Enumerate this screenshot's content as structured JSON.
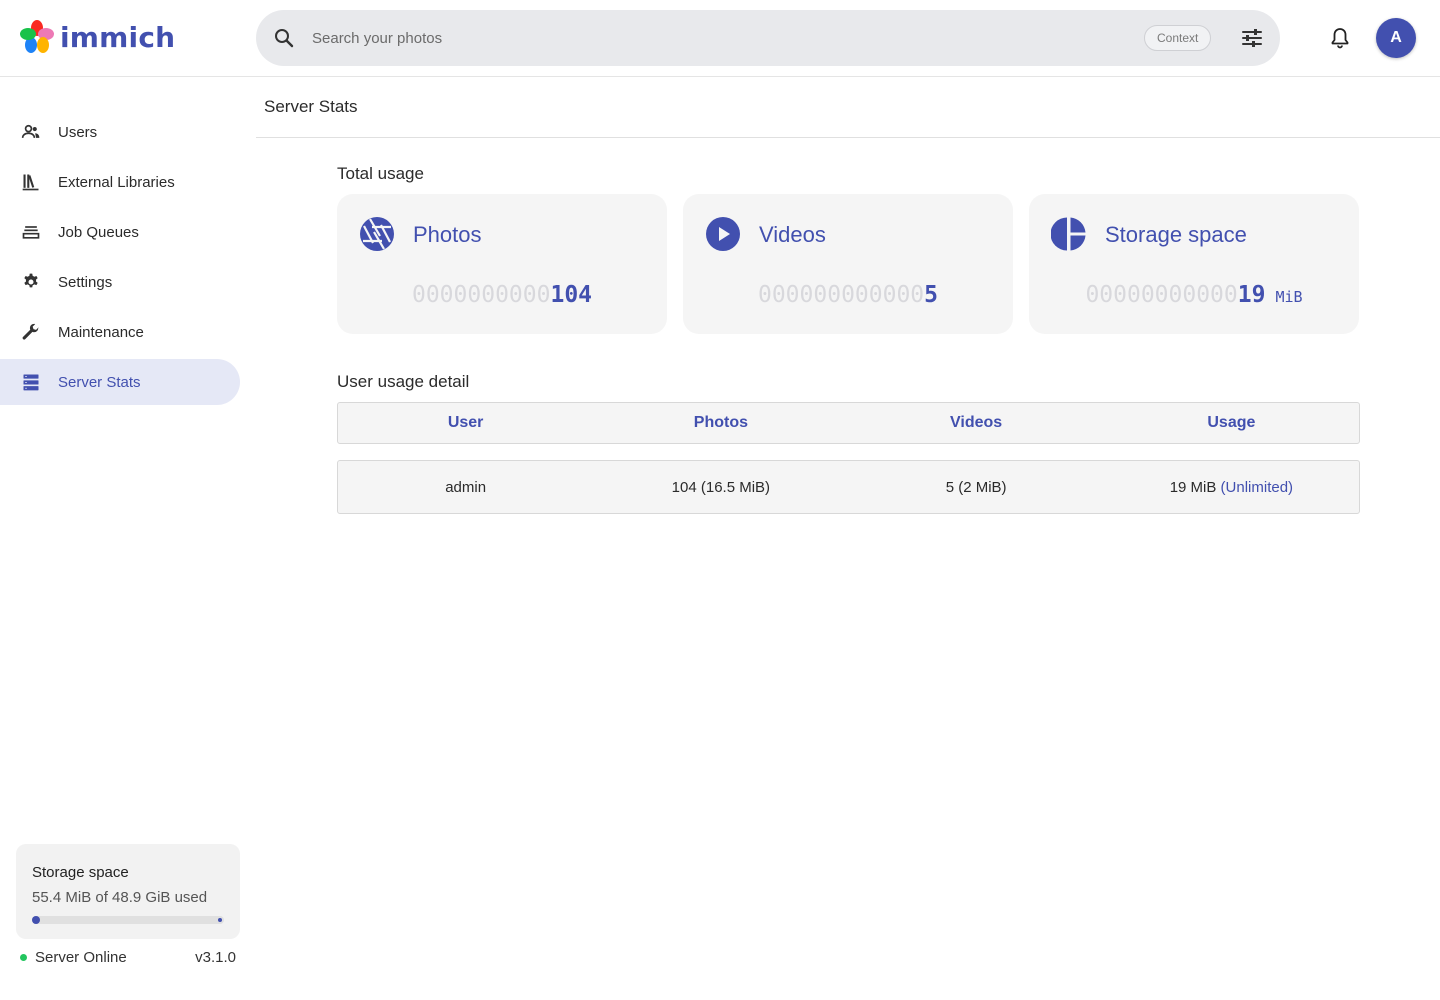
{
  "header": {
    "app_name": "immich",
    "search_placeholder": "Search your photos",
    "context_label": "Context",
    "avatar_initial": "A"
  },
  "sidebar": {
    "items": [
      {
        "label": "Users",
        "icon": "users-icon",
        "active": false
      },
      {
        "label": "External Libraries",
        "icon": "library-icon",
        "active": false
      },
      {
        "label": "Job Queues",
        "icon": "job-queues-icon",
        "active": false
      },
      {
        "label": "Settings",
        "icon": "gear-icon",
        "active": false
      },
      {
        "label": "Maintenance",
        "icon": "wrench-icon",
        "active": false
      },
      {
        "label": "Server Stats",
        "icon": "server-icon",
        "active": true
      }
    ],
    "storage": {
      "title": "Storage space",
      "used_text": "55.4 MiB of 48.9 GiB used",
      "used_fraction": 0.0011
    },
    "server_status": "Server Online",
    "version": "v3.1.0"
  },
  "main": {
    "page_title": "Server Stats",
    "total_usage_title": "Total usage",
    "cards": {
      "photos": {
        "label": "Photos",
        "padding": "0000000000",
        "value": "104",
        "unit": ""
      },
      "videos": {
        "label": "Videos",
        "padding": "000000000000",
        "value": "5",
        "unit": ""
      },
      "storage": {
        "label": "Storage space",
        "padding": "00000000000",
        "value": "19",
        "unit": "MiB"
      }
    },
    "user_usage_title": "User usage detail",
    "table": {
      "headers": [
        "User",
        "Photos",
        "Videos",
        "Usage"
      ],
      "rows": [
        {
          "user": "admin",
          "photos": "104 (16.5 MiB)",
          "videos": "5 (2 MiB)",
          "usage": "19 MiB",
          "quota": "(Unlimited)"
        }
      ]
    }
  },
  "colors": {
    "accent": "#4250af",
    "active_bg": "#e5e8f6",
    "online": "#22c55e"
  }
}
